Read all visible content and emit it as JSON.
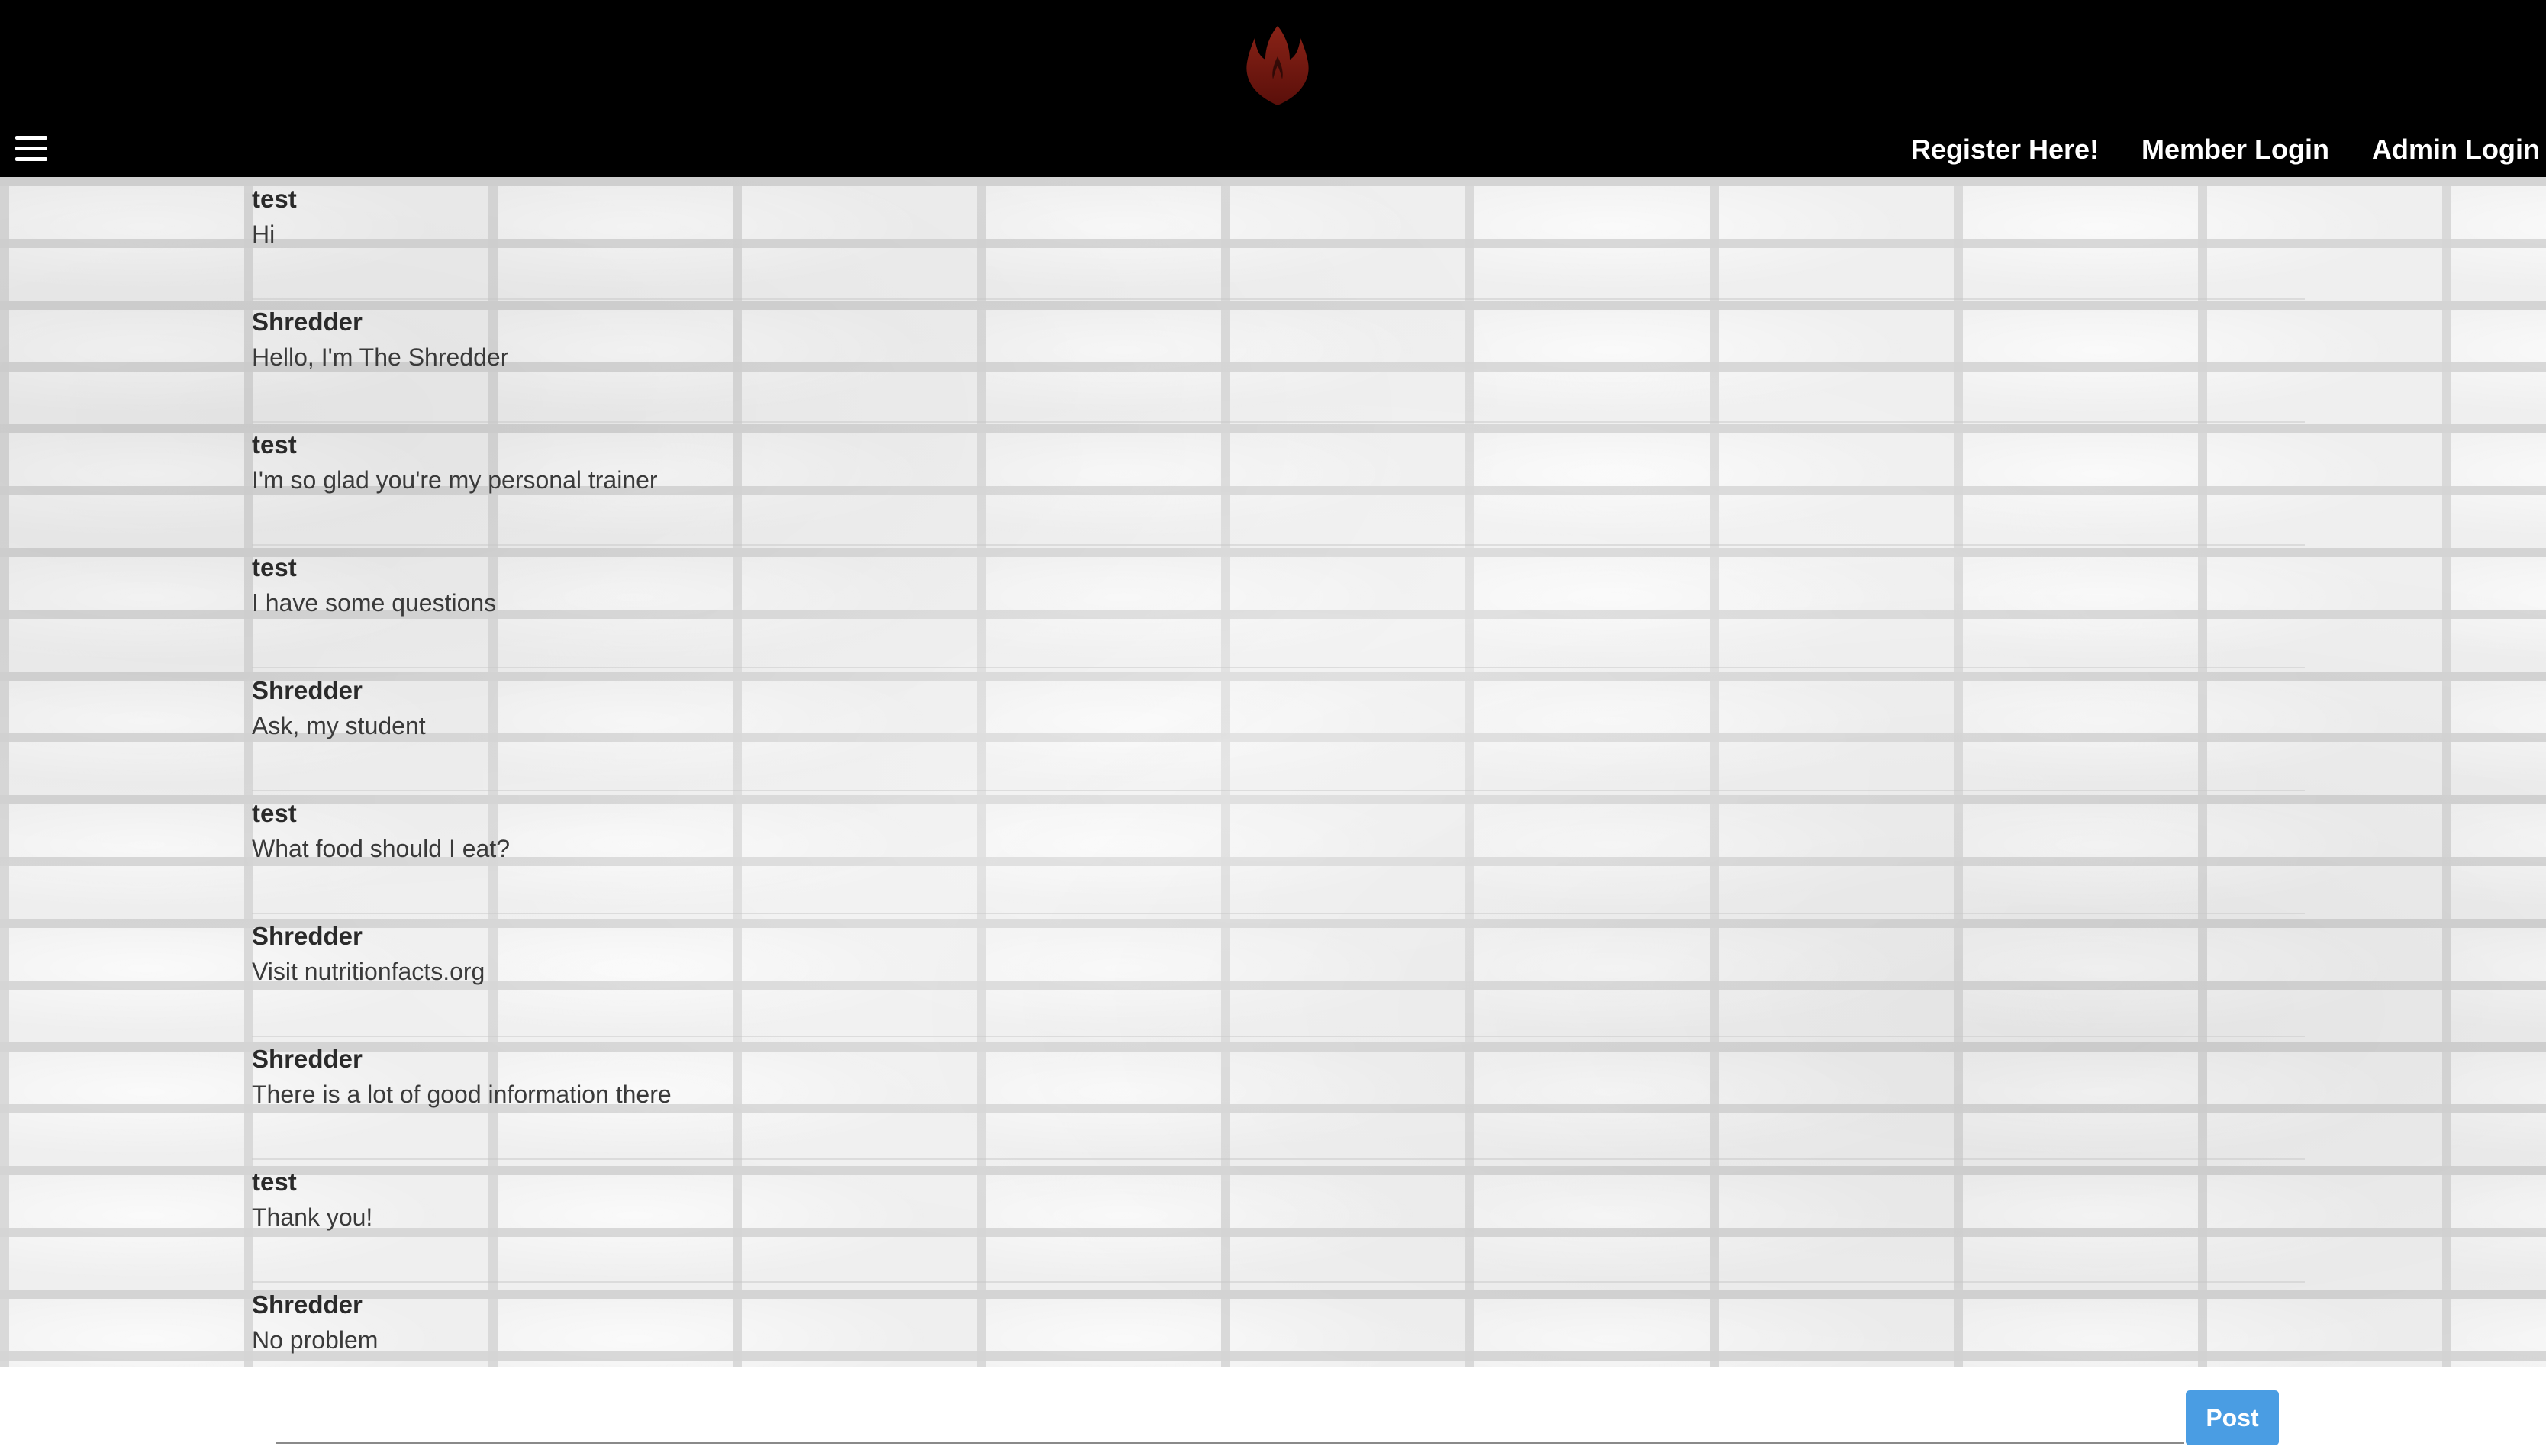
{
  "header": {
    "logo_icon": "flame-icon",
    "menu_icon": "hamburger-menu-icon",
    "nav": [
      {
        "label": "Register Here!"
      },
      {
        "label": "Member Login"
      },
      {
        "label": "Admin Login"
      }
    ]
  },
  "messages": [
    {
      "author": "test",
      "text": "Hi"
    },
    {
      "author": "Shredder",
      "text": "Hello, I'm The Shredder"
    },
    {
      "author": "test",
      "text": "I'm so glad you're my personal trainer"
    },
    {
      "author": "test",
      "text": "I have some questions"
    },
    {
      "author": "Shredder",
      "text": "Ask, my student"
    },
    {
      "author": "test",
      "text": "What food should I eat?"
    },
    {
      "author": "Shredder",
      "text": "Visit nutritionfacts.org"
    },
    {
      "author": "Shredder",
      "text": "There is a lot of good information there"
    },
    {
      "author": "test",
      "text": "Thank you!"
    },
    {
      "author": "Shredder",
      "text": "No problem"
    }
  ],
  "composer": {
    "value": "",
    "placeholder": "",
    "post_label": "Post"
  },
  "colors": {
    "header_bg": "#000000",
    "logo": "#7a1a12",
    "post_button": "#4a9de3"
  }
}
